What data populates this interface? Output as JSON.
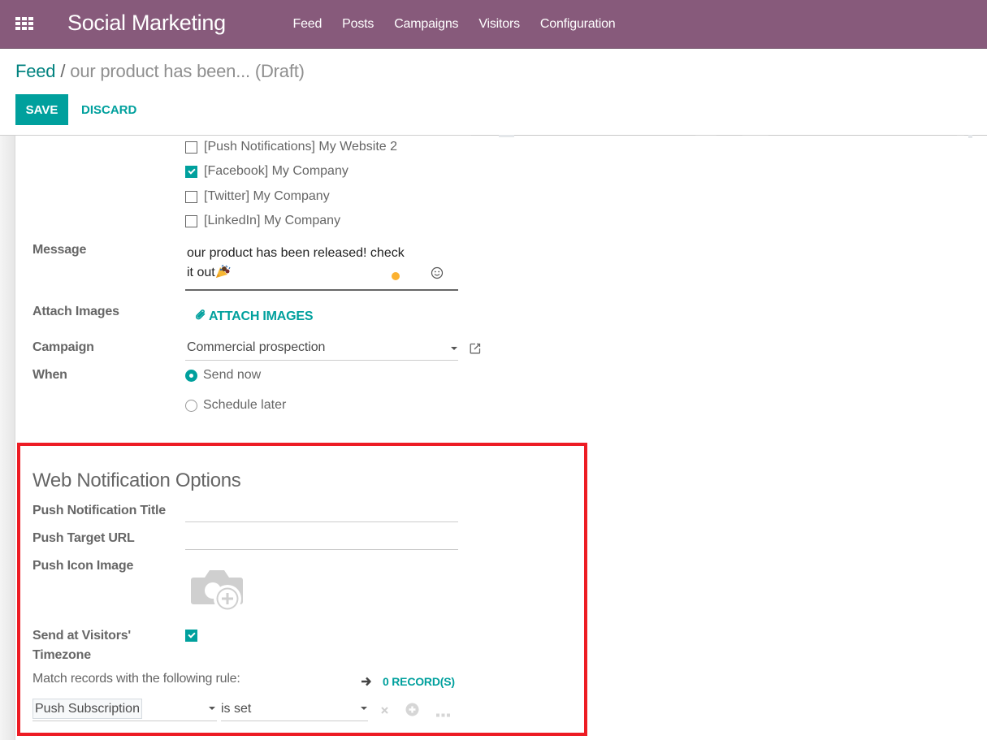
{
  "navbar": {
    "app_title": "Social Marketing",
    "menu": [
      {
        "label": "Feed"
      },
      {
        "label": "Posts"
      },
      {
        "label": "Campaigns"
      },
      {
        "label": "Visitors"
      },
      {
        "label": "Configuration"
      }
    ],
    "background_color": "#875a7b"
  },
  "breadcrumb": {
    "parent": "Feed",
    "separator": "/",
    "current": "our product has been... (Draft)"
  },
  "actions": {
    "save_label": "SAVE",
    "discard_label": "DISCARD",
    "accent_color": "#00a09d"
  },
  "form": {
    "accounts": [
      {
        "label": "[Push Notifications] My Website 2",
        "checked": false
      },
      {
        "label": "[Facebook] My Company",
        "checked": true
      },
      {
        "label": "[Twitter] My Company",
        "checked": false
      },
      {
        "label": "[LinkedIn] My Company",
        "checked": false
      }
    ],
    "message": {
      "label": "Message",
      "line1": "our product has been released! check",
      "line2": "it out",
      "emoji_icon": "party-popper-icon",
      "emoji_picker_icon": "smiley-icon"
    },
    "attach_images": {
      "label": "Attach Images",
      "button_label": "ATTACH IMAGES",
      "icon": "paperclip-icon"
    },
    "campaign": {
      "label": "Campaign",
      "value": "Commercial prospection"
    },
    "when": {
      "label": "When",
      "options": [
        {
          "label": "Send now",
          "selected": true
        },
        {
          "label": "Schedule later",
          "selected": false
        }
      ]
    }
  },
  "web_notification": {
    "section_title": "Web Notification Options",
    "push_title": {
      "label": "Push Notification Title",
      "value": ""
    },
    "push_url": {
      "label": "Push Target URL",
      "value": ""
    },
    "push_icon": {
      "label": "Push Icon Image",
      "icon": "camera-add-icon"
    },
    "visitor_timezone": {
      "label_line1": "Send at Visitors'",
      "label_line2": "Timezone",
      "checked": true
    },
    "rule": {
      "text": "Match records with the following rule:",
      "records_label": "0 RECORD(S)",
      "field": "Push Subscription",
      "operator": "is set"
    },
    "highlight_color": "#ed1c24"
  }
}
